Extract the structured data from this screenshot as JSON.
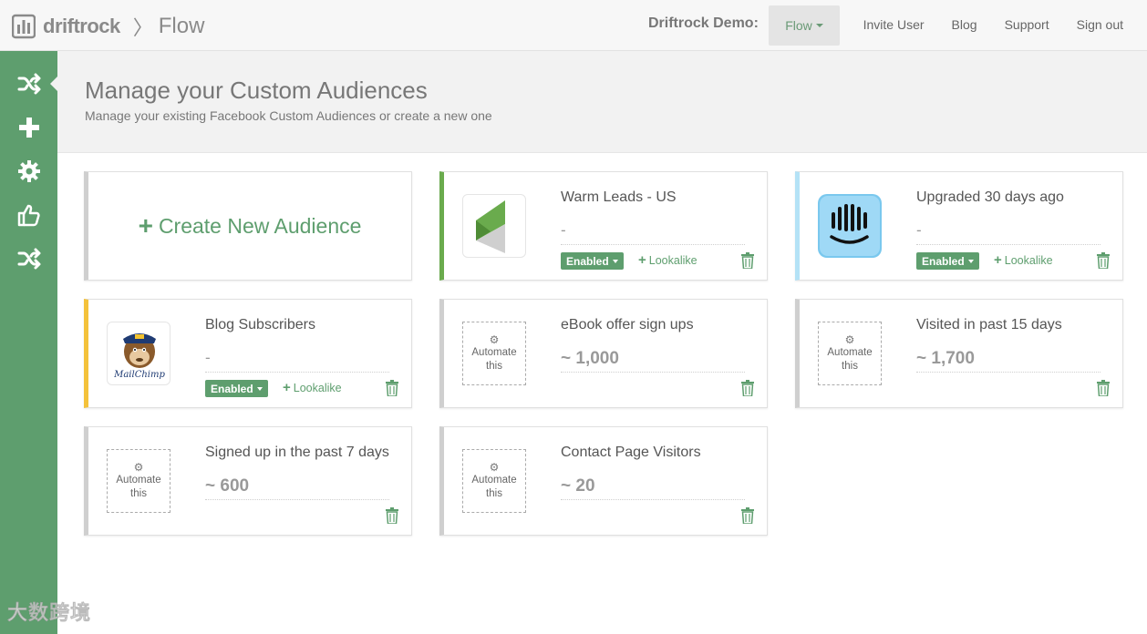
{
  "topbar": {
    "brand_name": "driftrock",
    "separator": "〉",
    "section": "Flow",
    "account_label": "Driftrock Demo:",
    "account_dropdown": "Flow",
    "nav": [
      "Invite User",
      "Blog",
      "Support",
      "Sign out"
    ]
  },
  "sidebar": {
    "icons": [
      "shuffle-icon",
      "plus-icon",
      "gear-icon",
      "thumbs-up-icon",
      "shuffle-icon"
    ]
  },
  "page": {
    "title": "Manage your Custom Audiences",
    "subtitle": "Manage your existing Facebook Custom Audiences or create a new one"
  },
  "create_card": {
    "plus": "+",
    "label": "Create New Audience"
  },
  "audiences": [
    {
      "name": "Warm Leads - US",
      "size": "-",
      "thumb": "lead-logo",
      "status": "Enabled",
      "lookalike": "Lookalike",
      "accent": "#6aab4d"
    },
    {
      "name": "Upgraded 30 days ago",
      "size": "-",
      "thumb": "intercom-logo",
      "status": "Enabled",
      "lookalike": "Lookalike",
      "accent": "#b4e2f6"
    },
    {
      "name": "Blog Subscribers",
      "size": "-",
      "thumb": "mailchimp-logo",
      "thumb_text": "MailChimp",
      "status": "Enabled",
      "lookalike": "Lookalike",
      "accent": "#f4c23b"
    },
    {
      "name": "eBook offer sign ups",
      "size": "~ 1,000",
      "automate_line1": "Automate",
      "automate_line2": "this"
    },
    {
      "name": "Visited in past 15 days",
      "size": "~ 1,700",
      "automate_line1": "Automate",
      "automate_line2": "this"
    },
    {
      "name": "Signed up in the past 7 days",
      "size": "~ 600",
      "automate_line1": "Automate",
      "automate_line2": "this"
    },
    {
      "name": "Contact Page Visitors",
      "size": "~ 20",
      "automate_line1": "Automate",
      "automate_line2": "this"
    }
  ],
  "watermark": "大数跨境",
  "colors": {
    "brand_green": "#5e9e6e",
    "sidebar": "#5e9e6e",
    "header_bg": "#f2f2f2"
  }
}
